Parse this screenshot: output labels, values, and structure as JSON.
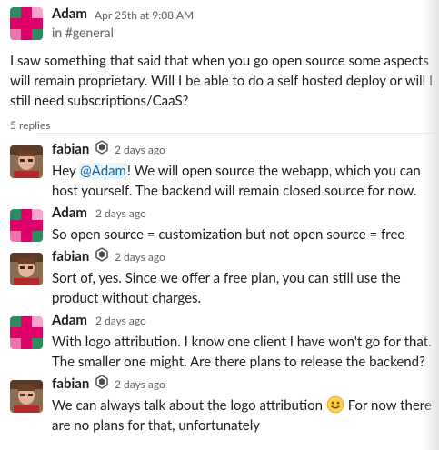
{
  "parent": {
    "author": "Adam",
    "timestamp": "Apr 25th at 9:08 AM",
    "channel_line": "in #general",
    "text": "I saw something that said that when you go open source some aspects will remain proprietary. Will I be able to do a self hosted deploy or will I still need subscriptions/CaaS?"
  },
  "replies_label": "5 replies",
  "replies": [
    {
      "author": "fabian",
      "time": "2 days ago",
      "pre": "Hey ",
      "mention": "@Adam",
      "post": "! We will open source the webapp, which you can host yourself. The backend will remain closed source for now."
    },
    {
      "author": "Adam",
      "time": "2 days ago",
      "text": "So open source = customization but not open source = free"
    },
    {
      "author": "fabian",
      "time": "2 days ago",
      "text": "Sort of, yes. Since we offer a free plan, you can still use the product without charges."
    },
    {
      "author": "Adam",
      "time": "2 days ago",
      "text": "With logo attribution. I know one client I have won't go for that. The smaller one might. Are there plans to release the backend?"
    },
    {
      "author": "fabian",
      "time": "2 days ago",
      "pre": "We can always talk about the logo attribution ",
      "post": " For now there are no plans for that, unfortunately",
      "emoji": "slightly-smiling-face"
    }
  ],
  "colors": {
    "mention_text": "#1264a3",
    "mention_bg": "#e8f5fa",
    "muted": "#616061",
    "text": "#1d1c1d",
    "adam_avatar_pink": "#e0006a",
    "adam_avatar_green": "#2a8c5f"
  }
}
